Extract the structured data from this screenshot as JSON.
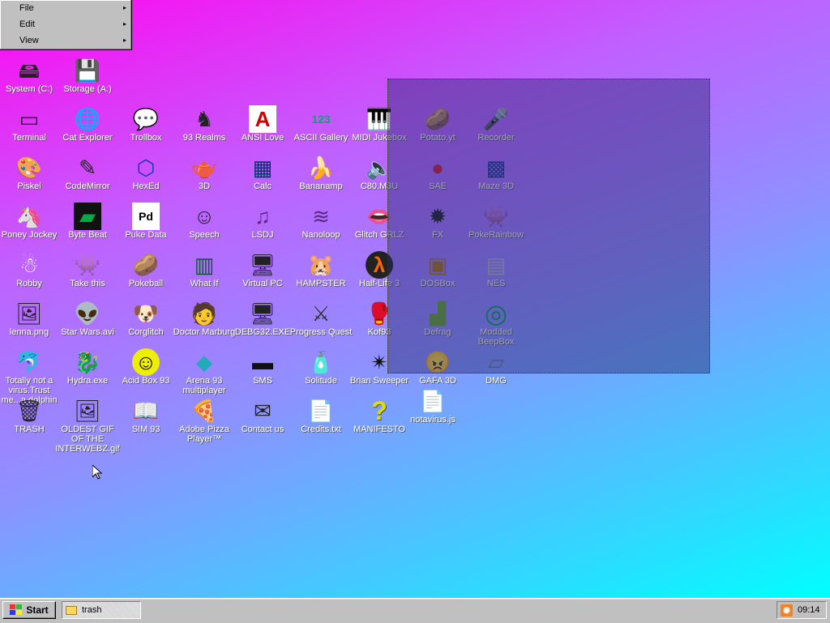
{
  "menu": {
    "items": [
      {
        "label": "File",
        "arrow": "▸"
      },
      {
        "label": "Edit",
        "arrow": "▸"
      },
      {
        "label": "View",
        "arrow": "▸"
      }
    ]
  },
  "icons": [
    {
      "label": "System (C:)",
      "glyph": "🖴"
    },
    {
      "label": "Storage (A:)",
      "glyph": "💾"
    },
    {
      "label": "Terminal",
      "glyph": "▭"
    },
    {
      "label": "Cat Explorer",
      "glyph": "🌐"
    },
    {
      "label": "Trollbox",
      "glyph": "💬"
    },
    {
      "label": "93 Realms",
      "glyph": "♞"
    },
    {
      "label": "ANSI Love",
      "glyph": "A"
    },
    {
      "label": "ASCII Gallery",
      "glyph": "123"
    },
    {
      "label": "MIDI Jukebox",
      "glyph": "🎹"
    },
    {
      "label": "Potato.yt",
      "glyph": "🥔"
    },
    {
      "label": "Recorder",
      "glyph": "🎤"
    },
    {
      "label": "Piskel",
      "glyph": "🎨"
    },
    {
      "label": "CodeMirror",
      "glyph": "✎"
    },
    {
      "label": "HexEd",
      "glyph": "⬡"
    },
    {
      "label": "3D",
      "glyph": "🫖"
    },
    {
      "label": "Calc",
      "glyph": "▦"
    },
    {
      "label": "Bananamp",
      "glyph": "🍌"
    },
    {
      "label": "C80.M3U",
      "glyph": "🔈"
    },
    {
      "label": "SAE",
      "glyph": "●"
    },
    {
      "label": "Maze 3D",
      "glyph": "▩"
    },
    {
      "label": "Poney Jockey",
      "glyph": "🦄"
    },
    {
      "label": "Byte Beat",
      "glyph": "▰"
    },
    {
      "label": "Puke Data",
      "glyph": "Pd"
    },
    {
      "label": "Speech",
      "glyph": "☺"
    },
    {
      "label": "LSDJ",
      "glyph": "♫"
    },
    {
      "label": "Nanoloop",
      "glyph": "≋"
    },
    {
      "label": "Glitch GRLZ",
      "glyph": "👄"
    },
    {
      "label": "FX",
      "glyph": "✹"
    },
    {
      "label": "PokeRainbow",
      "glyph": "👾"
    },
    {
      "label": "Robby",
      "glyph": "☃"
    },
    {
      "label": "Take this",
      "glyph": "👾"
    },
    {
      "label": "Pokeball",
      "glyph": "🥔"
    },
    {
      "label": "What If",
      "glyph": "▥"
    },
    {
      "label": "Virtual PC",
      "glyph": "🖥"
    },
    {
      "label": "HAMPSTER",
      "glyph": "🐹"
    },
    {
      "label": "Half-Life 3",
      "glyph": "λ"
    },
    {
      "label": "DOSBox",
      "glyph": "▣"
    },
    {
      "label": "NES",
      "glyph": "▤"
    },
    {
      "label": "lenna.png",
      "glyph": "🖼"
    },
    {
      "label": "Star Wars.avi",
      "glyph": "👽"
    },
    {
      "label": "Corglitch",
      "glyph": "🐶"
    },
    {
      "label": "Doctor Marburg",
      "glyph": "🧑"
    },
    {
      "label": "DEBG32.EXE",
      "glyph": "🖥"
    },
    {
      "label": "Progress Quest",
      "glyph": "⚔"
    },
    {
      "label": "Kof93",
      "glyph": "🥊"
    },
    {
      "label": "Defrag",
      "glyph": "▟"
    },
    {
      "label": "Modded BeepBox",
      "glyph": "◎"
    },
    {
      "label": "Totally not a virus.Trust me...a dolphin",
      "glyph": "🐬"
    },
    {
      "label": "Hydra.exe",
      "glyph": "🐉"
    },
    {
      "label": "Acid Box 93",
      "glyph": "☺"
    },
    {
      "label": "Arena 93 multiplayer",
      "glyph": "◆"
    },
    {
      "label": "SMS",
      "glyph": "▬"
    },
    {
      "label": "Solitude",
      "glyph": "🧴"
    },
    {
      "label": "Brian Sweeper",
      "glyph": "✴"
    },
    {
      "label": "GAFA 3D",
      "glyph": "😠"
    },
    {
      "label": "DMG",
      "glyph": "▱"
    },
    {
      "label": "TRASH",
      "glyph": "🗑"
    },
    {
      "label": "OLDEST GIF OF THE INTERWEBZ.gif",
      "glyph": "🖼"
    },
    {
      "label": "SIM 93",
      "glyph": "📖"
    },
    {
      "label": "Adobe Pizza Player™",
      "glyph": "🍕"
    },
    {
      "label": "Contact us",
      "glyph": "✉"
    },
    {
      "label": "Credits.txt",
      "glyph": "📄"
    },
    {
      "label": "MANIFESTO",
      "glyph": "?"
    },
    {
      "label": "notavirus.js",
      "glyph": "📄"
    }
  ],
  "taskbar": {
    "start_label": "Start",
    "task_label": "trash",
    "clock": "09:14"
  }
}
